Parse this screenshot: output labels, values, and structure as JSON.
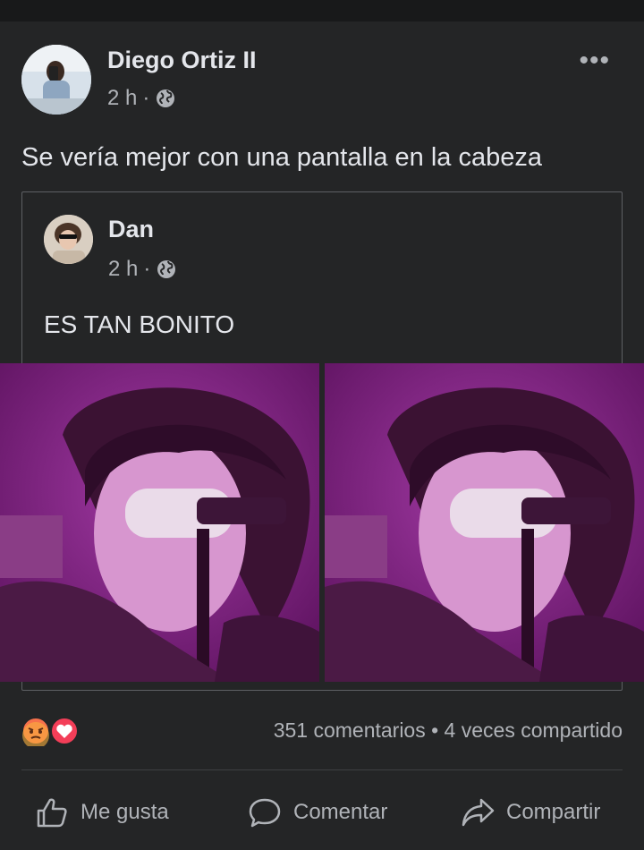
{
  "post": {
    "author": "Diego Ortiz II",
    "time": "2 h",
    "separator": "·",
    "text": "Se vería mejor con una pantalla en la cabeza",
    "more_icon": "more-horizontal-icon",
    "privacy_icon": "globe-icon"
  },
  "shared_post": {
    "author": "Dan",
    "time": "2 h",
    "separator": "·",
    "text": "ES TAN BONITO",
    "privacy_icon": "globe-icon"
  },
  "stats": {
    "reactions": [
      "angry-reaction-icon",
      "love-reaction-icon"
    ],
    "text": "351 comentarios • 4 veces compartido"
  },
  "actions": {
    "like": "Me gusta",
    "comment": "Comentar",
    "share": "Compartir"
  },
  "colors": {
    "background": "#242526",
    "text": "#e4e6eb",
    "muted": "#b0b3b8",
    "photo_tint": "#7a1a78"
  }
}
